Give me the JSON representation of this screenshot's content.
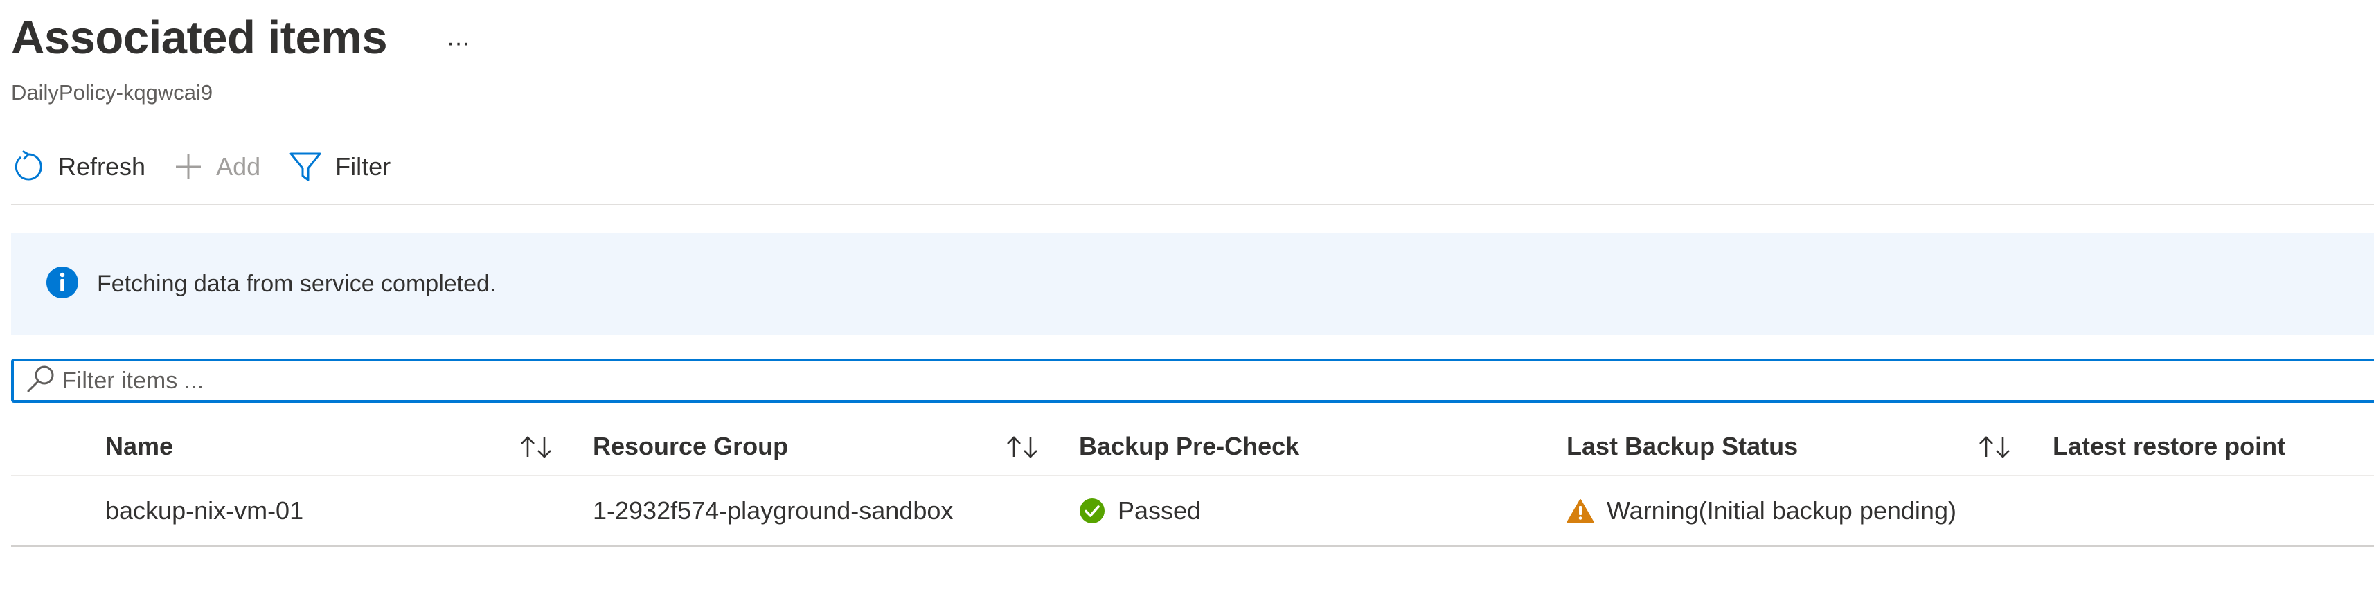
{
  "header": {
    "title": "Associated items",
    "more_label": "···",
    "subtitle": "DailyPolicy-kqgwcai9"
  },
  "toolbar": {
    "refresh_label": "Refresh",
    "add_label": "Add",
    "filter_label": "Filter"
  },
  "banner": {
    "icon": "info-icon",
    "message": "Fetching data from service completed."
  },
  "filter": {
    "placeholder": "Filter items ...",
    "value": ""
  },
  "grid": {
    "columns": [
      {
        "label": "Name",
        "sortable": true
      },
      {
        "label": "Resource Group",
        "sortable": true
      },
      {
        "label": "Backup Pre-Check",
        "sortable": false
      },
      {
        "label": "Last Backup Status",
        "sortable": true
      },
      {
        "label": "Latest restore point",
        "sortable": false
      }
    ],
    "rows": [
      {
        "name": "backup-nix-vm-01",
        "resource_group": "1-2932f574-playground-sandbox",
        "precheck": "Passed",
        "precheck_icon": "check-circle-icon",
        "last_backup_status": "Warning(Initial backup pending)",
        "last_backup_icon": "warning-icon",
        "latest_restore_point": ""
      }
    ]
  },
  "colors": {
    "accent": "#0078d4",
    "banner_bg": "#f0f6fd",
    "success": "#57a300",
    "warning": "#d67f0e"
  }
}
